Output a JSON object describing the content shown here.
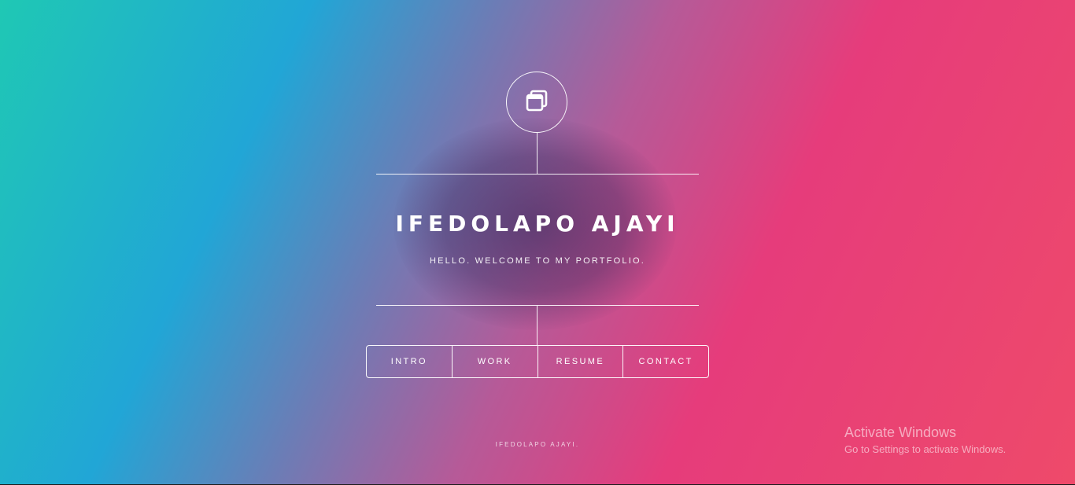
{
  "header": {
    "logo_icon": "window-stack-icon"
  },
  "intro": {
    "name": "IFEDOLAPO AJAYI",
    "tagline": "HELLO. WELCOME TO MY PORTFOLIO."
  },
  "nav": {
    "items": [
      {
        "label": "INTRO"
      },
      {
        "label": "WORK"
      },
      {
        "label": "RESUME"
      },
      {
        "label": "CONTACT"
      }
    ]
  },
  "footer": {
    "copyright": "IFEDOLAPO AJAYI."
  },
  "watermark": {
    "title": "Activate Windows",
    "subtitle": "Go to Settings to activate Windows."
  },
  "colors": {
    "gradient_start": "#1fc8b4",
    "gradient_mid": "#21a6d6",
    "gradient_end": "#e63c7b",
    "text": "#ffffff"
  }
}
